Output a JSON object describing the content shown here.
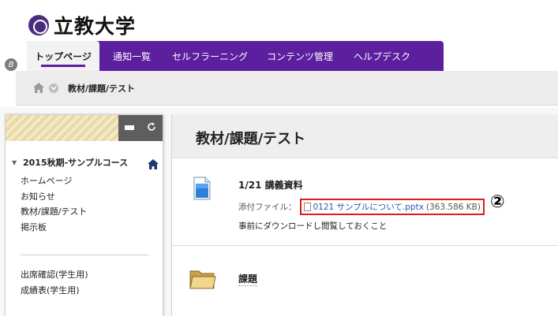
{
  "header": {
    "logo_text": "立教大学",
    "edge_badge": "B"
  },
  "nav": {
    "tabs": [
      {
        "label": "トップページ",
        "active": true
      },
      {
        "label": "通知一覧",
        "active": false
      },
      {
        "label": "セルフラーニング",
        "active": false
      },
      {
        "label": "コンテンツ管理",
        "active": false
      },
      {
        "label": "ヘルプデスク",
        "active": false
      }
    ]
  },
  "breadcrumb": {
    "current": "教材/課題/テスト"
  },
  "sidebar": {
    "course_name": "2015秋期-サンプルコース",
    "menu": [
      "ホームページ",
      "お知らせ",
      "教材/課題/テスト",
      "掲示板"
    ],
    "menu2": [
      "出席確認(学生用)",
      "成績表(学生用)"
    ]
  },
  "content": {
    "title": "教材/課題/テスト",
    "item1": {
      "title": "1/21 講義資料",
      "attach_label": "添付ファイル：",
      "file_name": "0121 サンプルについて.pptx",
      "file_size": "(363.586 KB)",
      "annotation": "②",
      "description": "事前にダウンロードし閲覧しておくこと"
    },
    "item2": {
      "title": "課題"
    }
  },
  "colors": {
    "nav_purple": "#5c1f9e",
    "link_blue": "#1a5fb4",
    "highlight_red": "#e11a1a"
  }
}
